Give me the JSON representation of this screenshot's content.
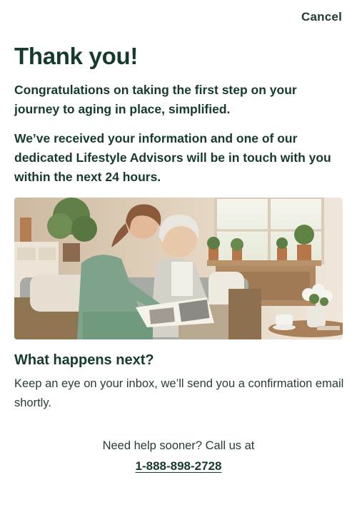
{
  "header": {
    "cancel_label": "Cancel"
  },
  "main": {
    "title": "Thank you!",
    "intro": "Congratulations on taking the first step on your journey to aging in place, simplified.",
    "received": "We’ve received your information and one of our dedicated Lifestyle Advisors will be in touch with you within the next 24 hours.",
    "next_heading": "What happens next?",
    "next_text": "Keep an eye on your inbox, we’ll send you a confirmation email shortly."
  },
  "footer": {
    "help_text": "Need help sooner? Call us at",
    "phone": "1-888-898-2728"
  },
  "colors": {
    "primary_text": "#163a2b",
    "background": "#ffffff"
  }
}
